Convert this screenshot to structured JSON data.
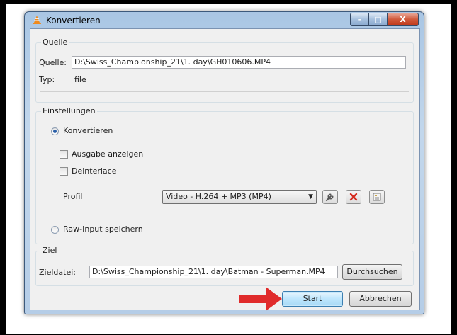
{
  "window": {
    "title": "Konvertieren",
    "min_glyph": "–",
    "max_glyph": "□",
    "close_glyph": "X"
  },
  "source": {
    "group_title": "Quelle",
    "source_label": "Quelle:",
    "source_value": "D:\\Swiss_Championship_21\\1. day\\GH010606.MP4",
    "type_label": "Typ:",
    "type_value": "file"
  },
  "settings": {
    "group_title": "Einstellungen",
    "convert_label": "Konvertieren",
    "show_output_label": "Ausgabe anzeigen",
    "deinterlace_label": "Deinterlace",
    "profile_label": "Profil",
    "profile_value": "Video - H.264 + MP3 (MP4)",
    "raw_input_label": "Raw-Input speichern"
  },
  "target": {
    "group_title": "Ziel",
    "file_label": "Zieldatei:",
    "file_value": "D:\\Swiss_Championship_21\\1. day\\Batman - Superman.MP4",
    "browse_label": "Durchsuchen"
  },
  "buttons": {
    "start_accel": "S",
    "start_rest": "tart",
    "cancel_accel": "A",
    "cancel_rest": "bbrechen"
  },
  "colors": {
    "accent_arrow": "#e02b2b",
    "delete_icon": "#d42a1e",
    "titlebar": "#b5cde7"
  }
}
